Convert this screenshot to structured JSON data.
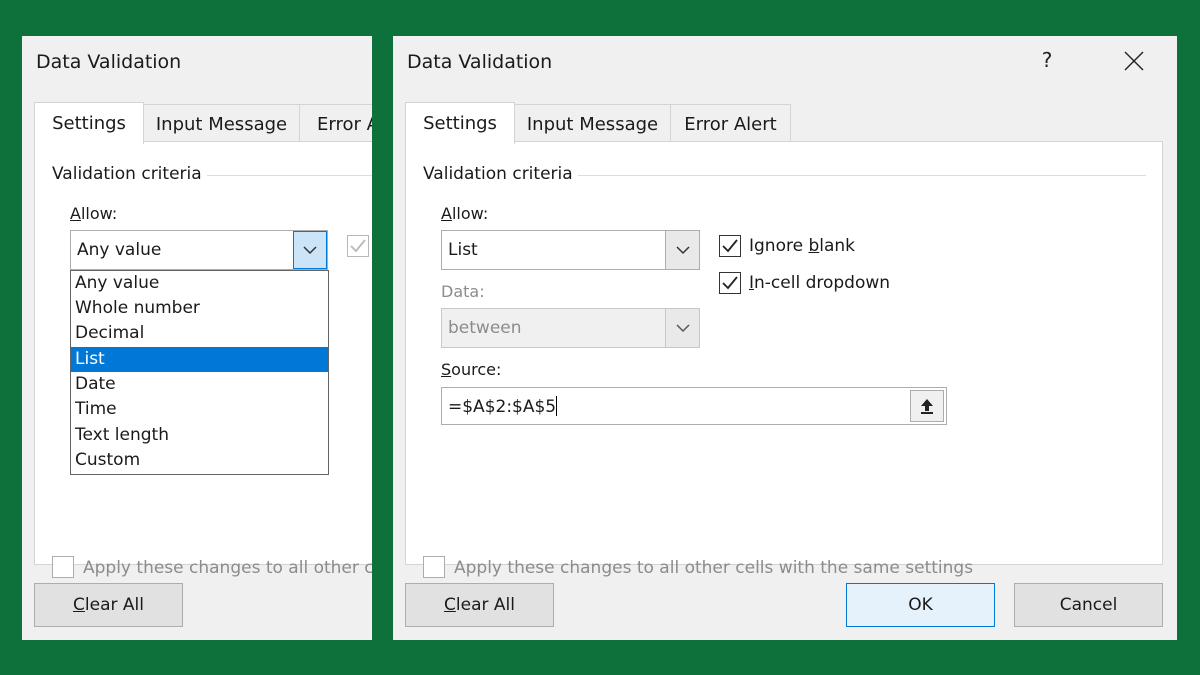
{
  "left_dialog": {
    "title": "Data Validation",
    "tabs": [
      "Settings",
      "Input Message",
      "Error A"
    ],
    "criteria_label": "Validation criteria",
    "allow_label": "Allow:",
    "allow_value": "Any value",
    "dropdown_options": [
      "Any value",
      "Whole number",
      "Decimal",
      "List",
      "Date",
      "Time",
      "Text length",
      "Custom"
    ],
    "dropdown_selected_index": 3,
    "apply_label": "Apply these changes to all other ce",
    "clear_all": "Clear All"
  },
  "right_dialog": {
    "title": "Data Validation",
    "help_symbol": "?",
    "tabs": [
      "Settings",
      "Input Message",
      "Error Alert"
    ],
    "criteria_label": "Validation criteria",
    "allow_label": "Allow:",
    "allow_value": "List",
    "ignore_blank_label": "Ignore blank",
    "ignore_blank_checked": true,
    "in_cell_dropdown_label": "In-cell dropdown",
    "in_cell_dropdown_checked": true,
    "data_label": "Data:",
    "data_value": "between",
    "source_label": "Source:",
    "source_value": "=$A$2:$A$5",
    "apply_label": "Apply these changes to all other cells with the same settings",
    "clear_all": "Clear All",
    "ok": "OK",
    "cancel": "Cancel"
  },
  "colors": {
    "background": "#0e703a",
    "selection": "#0078d7"
  }
}
